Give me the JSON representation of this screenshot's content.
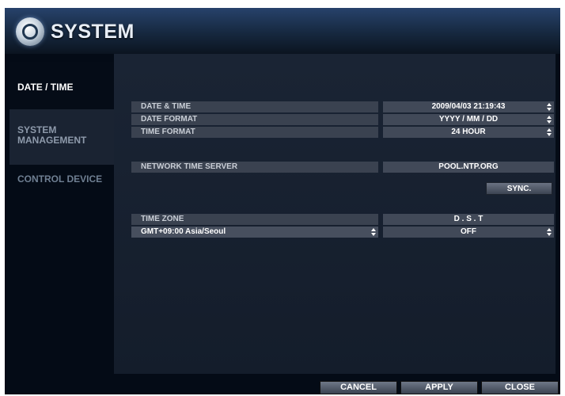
{
  "app": {
    "title": "SYSTEM"
  },
  "sidebar": {
    "items": [
      {
        "label": "DATE / TIME"
      },
      {
        "label": "SYSTEM MANAGEMENT"
      },
      {
        "label": "CONTROL DEVICE"
      }
    ]
  },
  "settings": {
    "date_time": {
      "label": "DATE & TIME",
      "value": "2009/04/03  21:19:43"
    },
    "date_format": {
      "label": "DATE FORMAT",
      "value": "YYYY / MM / DD"
    },
    "time_format": {
      "label": "TIME FORMAT",
      "value": "24 HOUR"
    },
    "ntp": {
      "label": "NETWORK TIME SERVER",
      "value": "POOL.NTP.ORG",
      "sync_label": "SYNC."
    },
    "time_zone": {
      "label": "TIME ZONE",
      "value": "GMT+09:00 Asia/Seoul"
    },
    "dst": {
      "label": "D . S . T",
      "value": "OFF"
    }
  },
  "footer": {
    "cancel_label": "CANCEL",
    "apply_label": "APPLY",
    "close_label": "CLOSE"
  },
  "colors": {
    "accent": "#1a3f9e",
    "header": "#27426b",
    "panel": "#1a2434",
    "field": "#3a4250"
  }
}
